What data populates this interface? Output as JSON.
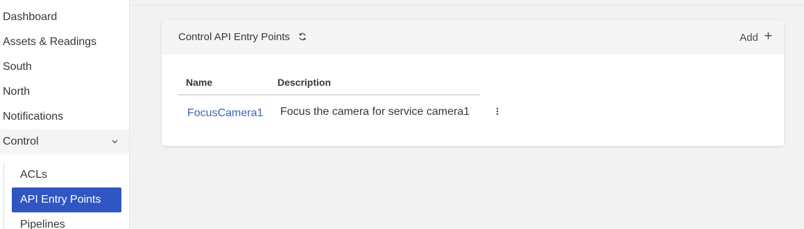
{
  "sidebar": {
    "items": [
      {
        "label": "Dashboard"
      },
      {
        "label": "Assets & Readings"
      },
      {
        "label": "South"
      },
      {
        "label": "North"
      },
      {
        "label": "Notifications"
      },
      {
        "label": "Control",
        "expanded": true
      }
    ],
    "control_submenu": [
      {
        "label": "ACLs"
      },
      {
        "label": "API Entry Points",
        "active": true
      },
      {
        "label": "Pipelines"
      }
    ]
  },
  "card": {
    "title": "Control API Entry Points",
    "add_label": "Add",
    "icons": {
      "refresh": "refresh-icon",
      "add": "plus-icon",
      "menu": "kebab-menu-icon",
      "expand": "chevron-down-icon"
    }
  },
  "table": {
    "columns": [
      "Name",
      "Description"
    ],
    "rows": [
      {
        "name": "FocusCamera1",
        "description": "Focus the camera for service camera1"
      }
    ]
  },
  "colors": {
    "accent": "#3056c4",
    "link": "#3e64b8",
    "header_bg": "#f5f5f5",
    "page_bg": "#f2f2f2"
  }
}
